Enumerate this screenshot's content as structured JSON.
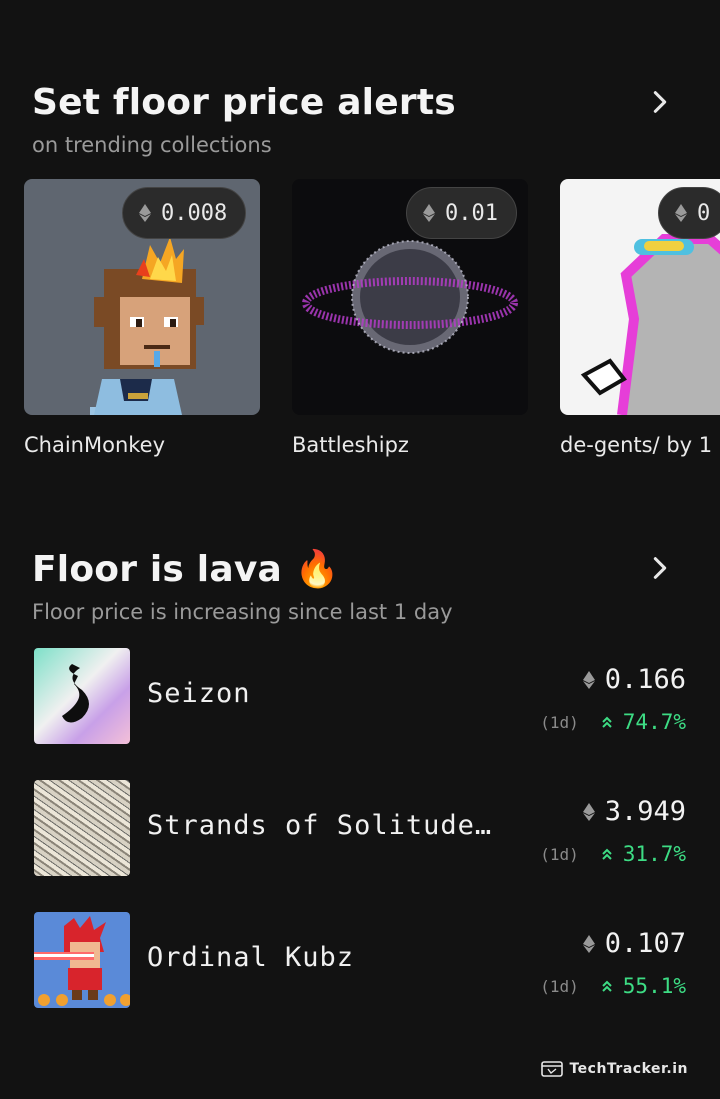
{
  "alerts": {
    "title": "Set floor price alerts",
    "subtitle": "on trending collections",
    "collections": [
      {
        "name": "ChainMonkey",
        "price": "0.008"
      },
      {
        "name": "Battleshipz",
        "price": "0.01"
      },
      {
        "name": "de-gents/ by 1",
        "price": "0"
      }
    ]
  },
  "lava": {
    "title": "Floor is lava",
    "emoji": "🔥",
    "subtitle": "Floor price is increasing since last 1 day",
    "items": [
      {
        "name": "Seizon",
        "price": "0.166",
        "period": "(1d)",
        "change": "74.7%"
      },
      {
        "name": "Strands of Solitude…",
        "price": "3.949",
        "period": "(1d)",
        "change": "31.7%"
      },
      {
        "name": "Ordinal Kubz",
        "price": "0.107",
        "period": "(1d)",
        "change": "55.1%"
      }
    ]
  },
  "watermark": {
    "text": "TechTracker.in"
  },
  "colors": {
    "background": "#121212",
    "positive": "#3ddc84",
    "pill": "#2b2b2b"
  }
}
